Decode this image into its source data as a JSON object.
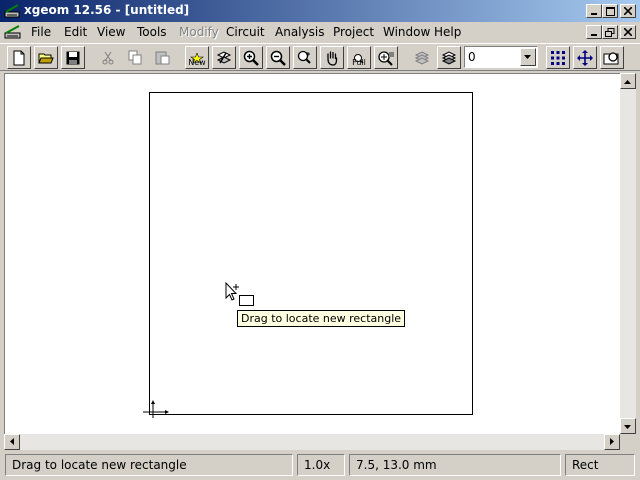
{
  "window": {
    "title": "xgeom 12.56 - [untitled]"
  },
  "menu": {
    "items": [
      {
        "label": "File"
      },
      {
        "label": "Edit"
      },
      {
        "label": "View"
      },
      {
        "label": "Tools"
      },
      {
        "label": "Modify",
        "disabled": true
      },
      {
        "label": "Circuit"
      },
      {
        "label": "Analysis"
      },
      {
        "label": "Project"
      },
      {
        "label": "Window"
      },
      {
        "label": "Help"
      }
    ]
  },
  "toolbar": {
    "new_geometry_label": "New",
    "zoom_full_label": "Full",
    "layer_value": "0"
  },
  "canvas": {
    "tooltip": "Drag to locate new rectangle"
  },
  "status": {
    "message": "Drag to locate new rectangle",
    "zoom": "1.0x",
    "coordinates": "7.5, 13.0 mm",
    "mode": "Rect"
  }
}
